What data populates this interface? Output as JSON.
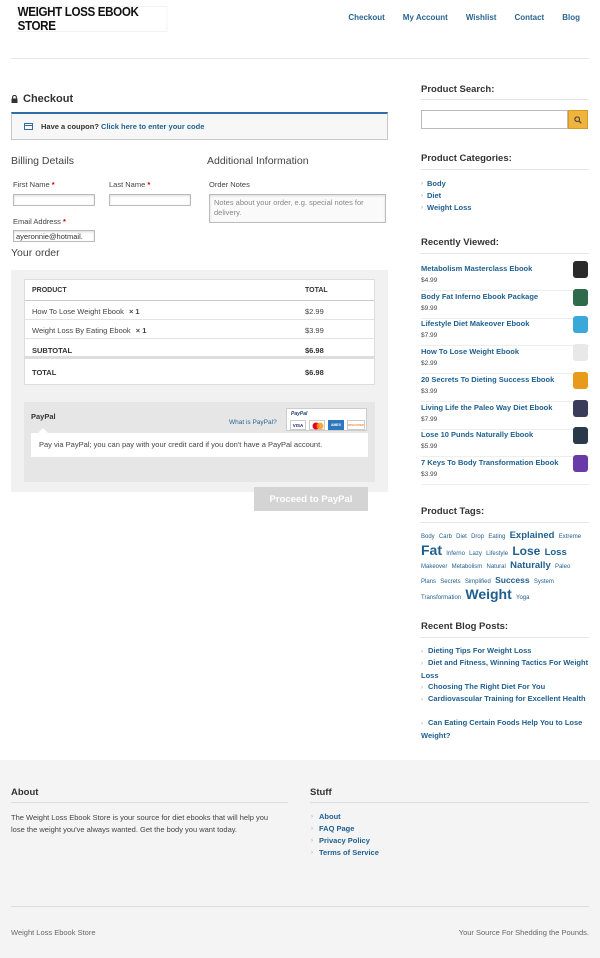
{
  "header": {
    "logo": "WEIGHT LOSS EBOOK STORE",
    "nav": [
      "Checkout",
      "My Account",
      "Wishlist",
      "Contact",
      "Blog"
    ]
  },
  "checkout": {
    "title": "Checkout",
    "coupon_text": "Have a coupon?",
    "coupon_link": "Click here to enter your code",
    "billing_title": "Billing Details",
    "additional_title": "Additional Information",
    "first_name_label": "First Name",
    "last_name_label": "Last Name",
    "email_label": "Email Address",
    "required_mark": "*",
    "email_value": "ayeronnie@hotmail.",
    "order_notes_label": "Order Notes",
    "order_notes_placeholder": "Notes about your order, e.g. special notes for delivery.",
    "your_order_title": "Your order",
    "table": {
      "col_product": "PRODUCT",
      "col_total": "TOTAL",
      "items": [
        {
          "name": "How To Lose Weight Ebook",
          "qty": "× 1",
          "total": "$2.99"
        },
        {
          "name": "Weight Loss By Eating Ebook",
          "qty": "× 1",
          "total": "$3.99"
        }
      ],
      "subtotal_label": "SUBTOTAL",
      "subtotal_value": "$6.98",
      "total_label": "TOTAL",
      "total_value": "$6.98"
    },
    "payment": {
      "method": "PayPal",
      "what_link": "What is PayPal?",
      "description": "Pay via PayPal; you can pay with your credit card if you don't have a PayPal account.",
      "logo_text": "PayPal",
      "card_visa": "VISA",
      "card_amex": "AMEX",
      "card_discover": "DISCOVER"
    },
    "proceed_button": "Proceed to PayPal"
  },
  "sidebar": {
    "search_title": "Product Search:",
    "categories_title": "Product Categories:",
    "categories": [
      "Body",
      "Diet",
      "Weight Loss"
    ],
    "recent_title": "Recently Viewed:",
    "recent": [
      {
        "name": "Metabolism Masterclass Ebook",
        "price": "$4.99",
        "color": "#2b2b2b"
      },
      {
        "name": "Body Fat Inferno Ebook Package",
        "price": "$9.99",
        "color": "#2d6b4a"
      },
      {
        "name": "Lifestyle Diet Makeover Ebook",
        "price": "$7.99",
        "color": "#3aa8d8"
      },
      {
        "name": "How To Lose Weight Ebook",
        "price": "$2.99",
        "color": "#e8e8e8"
      },
      {
        "name": "20 Secrets To Dieting Success Ebook",
        "price": "$3.99",
        "color": "#e89a1a"
      },
      {
        "name": "Living Life the Paleo Way Diet Ebook",
        "price": "$7.99",
        "color": "#3b3b5a"
      },
      {
        "name": "Lose 10 Punds Naturally Ebook",
        "price": "$5.99",
        "color": "#2a3a4a"
      },
      {
        "name": "7 Keys To Body Transformation Ebook",
        "price": "$3.99",
        "color": "#6a3aa8"
      }
    ],
    "tags_title": "Product Tags:",
    "tags": [
      {
        "t": "Body",
        "s": 6
      },
      {
        "t": "Carb",
        "s": 6
      },
      {
        "t": "Diet",
        "s": 6
      },
      {
        "t": "Drop",
        "s": 6
      },
      {
        "t": "Eating",
        "s": 6
      },
      {
        "t": "Explained",
        "s": 9.5
      },
      {
        "t": "Extreme",
        "s": 6
      },
      {
        "t": "Fat",
        "s": 14
      },
      {
        "t": "Inferno",
        "s": 6
      },
      {
        "t": "Lazy",
        "s": 6
      },
      {
        "t": "Lifestyle",
        "s": 6
      },
      {
        "t": "Lose",
        "s": 12
      },
      {
        "t": "Loss",
        "s": 9.5
      },
      {
        "t": "Makeover",
        "s": 6
      },
      {
        "t": "Metabolism",
        "s": 6
      },
      {
        "t": "Natural",
        "s": 6
      },
      {
        "t": "Naturally",
        "s": 9.5
      },
      {
        "t": "Paleo",
        "s": 6
      },
      {
        "t": "Plans",
        "s": 6
      },
      {
        "t": "Secrets",
        "s": 6
      },
      {
        "t": "Simplified",
        "s": 6
      },
      {
        "t": "Success",
        "s": 8.5
      },
      {
        "t": "System",
        "s": 6
      },
      {
        "t": "Transformation",
        "s": 6
      },
      {
        "t": "Weight",
        "s": 14
      },
      {
        "t": "Yoga",
        "s": 6
      }
    ],
    "blog_title": "Recent Blog Posts:",
    "blog_posts": [
      "Dieting Tips For Weight Loss",
      "Diet and Fitness, Winning Tactics For Weight Loss",
      "Choosing The Right Diet For You",
      "Cardiovascular Training for Excellent Health",
      "Can Eating Certain Foods Help You to Lose Weight?"
    ]
  },
  "footer": {
    "about_title": "About",
    "about_text": "The Weight Loss Ebook Store is your source for diet ebooks that will help you lose the weight you've always wanted. Get the body you want today.",
    "stuff_title": "Stuff",
    "links": [
      "About",
      "FAQ Page",
      "Privacy Policy",
      "Terms of Service"
    ],
    "copyright": "Weight Loss Ebook Store",
    "tagline": "Your Source For Shedding the Pounds."
  }
}
